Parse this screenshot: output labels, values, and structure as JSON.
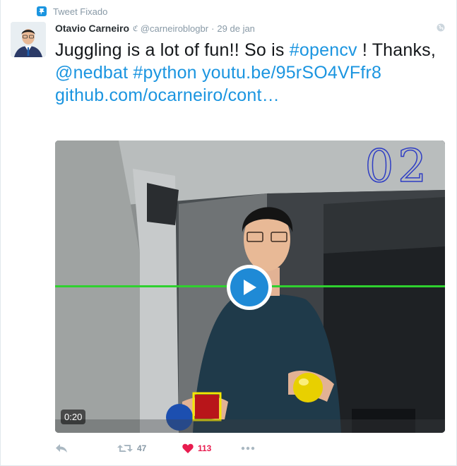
{
  "pinned": {
    "label": "Tweet Fixado"
  },
  "author": {
    "name": "Otavio Carneiro",
    "verified_glyph": "ℭ",
    "handle": "@carneiroblogbr",
    "separator": "·",
    "timestamp": "29 de jan"
  },
  "tweet": {
    "text_1": "Juggling is a lot of fun!! So is ",
    "hashtag_opencv": "#opencv",
    "text_2": " ! Thanks, ",
    "mention_nedbat": "@nedbat",
    "text_3": " ",
    "hashtag_python": "#python",
    "text_4": " ",
    "link_youtube": "youtu.be/95rSO4VFfr8",
    "text_5": " ",
    "link_github": "github.com/ocarneiro/cont…"
  },
  "media": {
    "overlay_counter": "02",
    "duration": "0:20"
  },
  "actions": {
    "retweet_count": "47",
    "like_count": "113"
  },
  "colors": {
    "link": "#1b95e0",
    "like": "#e81c4f",
    "muted": "#8899a6",
    "play": "#1f8ad6",
    "tracking_line": "#2fd12f",
    "tracking_box": "#f5e600"
  }
}
